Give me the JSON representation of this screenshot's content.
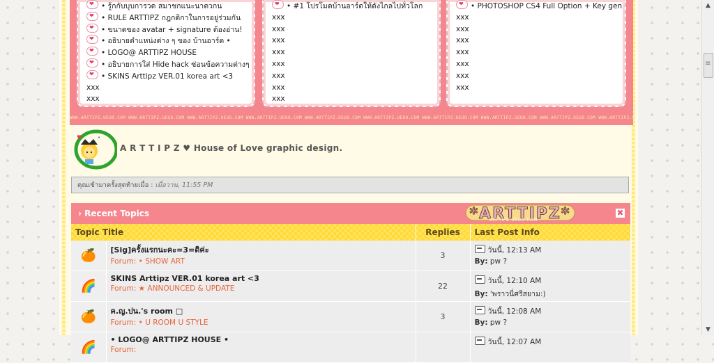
{
  "columns": [
    {
      "items": [
        {
          "emoticon": true,
          "text": "• รู้กกับบุบการวด สมาชกแนะนาตวกน"
        },
        {
          "emoticon": true,
          "text": "• RULE ARTTIPZ กฎกติกาในการอยู่ร่วมกัน"
        },
        {
          "emoticon": true,
          "text": "• ขนาดของ avatar + signature ต้องอ่าน!"
        },
        {
          "emoticon": true,
          "text": "• อธิบายตำแหน่งต่าง ๆ ของ บ้านอาร์ต •"
        },
        {
          "emoticon": true,
          "text": "• LOGO@ ARTTIPZ HOUSE"
        },
        {
          "emoticon": true,
          "text": "• อธิบายการใส่ Hide hack ซ่อนข้อความต่างๆ"
        },
        {
          "emoticon": true,
          "text": "• SKINS Arttipz VER.01 korea art <3"
        },
        {
          "emoticon": false,
          "text": "xxx"
        },
        {
          "emoticon": false,
          "text": "xxx"
        }
      ]
    },
    {
      "items": [
        {
          "emoticon": true,
          "text": "• #1 โปรโมตบ้านอาร์ตให้ดังไกลไปทั่วโลก"
        },
        {
          "emoticon": false,
          "text": "xxx"
        },
        {
          "emoticon": false,
          "text": "xxx"
        },
        {
          "emoticon": false,
          "text": "xxx"
        },
        {
          "emoticon": false,
          "text": "xxx"
        },
        {
          "emoticon": false,
          "text": "xxx"
        },
        {
          "emoticon": false,
          "text": "xxx"
        },
        {
          "emoticon": false,
          "text": "xxx"
        },
        {
          "emoticon": false,
          "text": "xxx"
        }
      ]
    },
    {
      "items": [
        {
          "emoticon": true,
          "text": "• PHOTOSHOP CS4 Full Option + Key gen"
        },
        {
          "emoticon": false,
          "text": "xxx"
        },
        {
          "emoticon": false,
          "text": "xxx"
        },
        {
          "emoticon": false,
          "text": "xxx"
        },
        {
          "emoticon": false,
          "text": "xxx"
        },
        {
          "emoticon": false,
          "text": "xxx"
        },
        {
          "emoticon": false,
          "text": "xxx"
        },
        {
          "emoticon": false,
          "text": "xxx"
        }
      ]
    }
  ],
  "watermark_text": "WWW.ARTTIPZ.UEUO.COM WWW.ARTTIPZ.UEUO.COM WWW.ARTTIPZ.UEUO.COM WWW.ARTTIPZ.UEUO.COM WWW.ARTTIPZ.UEUO.COM WWW.ARTTIPZ.UEUO.COM WWW.ARTTIPZ.UEUO.COM WWW.ARTTIPZ.UEUO.COM WWW.ARTTIPZ.UEUO.COM WWW.ARTTIPZ.UEUO.COM WWW.ARTTIPZ.UEUO.COM",
  "signature": {
    "text": "A R T T I P Z ♥ House of Love graphic design."
  },
  "last_visit": {
    "label": "คุณเข้ามาครั้งสุดท้ายเมื่อ :",
    "value": "เมื่อวาน, 11:55 PM"
  },
  "recent_topics": {
    "title": "Recent Topics",
    "logo_text": "*ARTTIPZ*",
    "logo_url": "ARTTIPZ.UEUO.COM",
    "close_glyph": "✖",
    "headers": {
      "topic": "Topic Title",
      "replies": "Replies",
      "last": "Last Post Info"
    },
    "rows": [
      {
        "icon": "🍊",
        "icon_name": "orange-icon",
        "title": "[Sig]ครั้งแรกนะคะ=3=ดิค่ะ",
        "forum_label": "Forum:",
        "forum": "• SHOW ART",
        "replies": "3",
        "time": "วันนี้, 12:13 AM",
        "by_label": "By:",
        "by": "pw ?"
      },
      {
        "icon": "🌈",
        "icon_name": "rainbow-icon",
        "title": "SKINS Arttipz VER.01 korea art <3",
        "forum_label": "Forum:",
        "forum": "★ ANNOUNCED & UPDATE",
        "replies": "22",
        "time": "วันนี้, 12:10 AM",
        "by_label": "By:",
        "by": "'พราวนี่ศรีสยาม:)"
      },
      {
        "icon": "🍊",
        "icon_name": "orange-icon",
        "title": "ค.ญ.ปน.'s room □",
        "forum_label": "Forum:",
        "forum": "• U ROOM U STYLE",
        "replies": "3",
        "time": "วันนี้, 12:08 AM",
        "by_label": "By:",
        "by": "pw ?"
      },
      {
        "icon": "🌈",
        "icon_name": "rainbow-icon",
        "title": "• LOGO@ ARTTIPZ HOUSE •",
        "forum_label": "Forum:",
        "forum": "",
        "replies": "",
        "time": "วันนี้, 12:07 AM",
        "by_label": "",
        "by": ""
      }
    ]
  },
  "colors": {
    "pink": "#f5868e",
    "yellow": "#ffe35a",
    "forum_link": "#e8653a",
    "green_circle": "#2ea32e"
  }
}
